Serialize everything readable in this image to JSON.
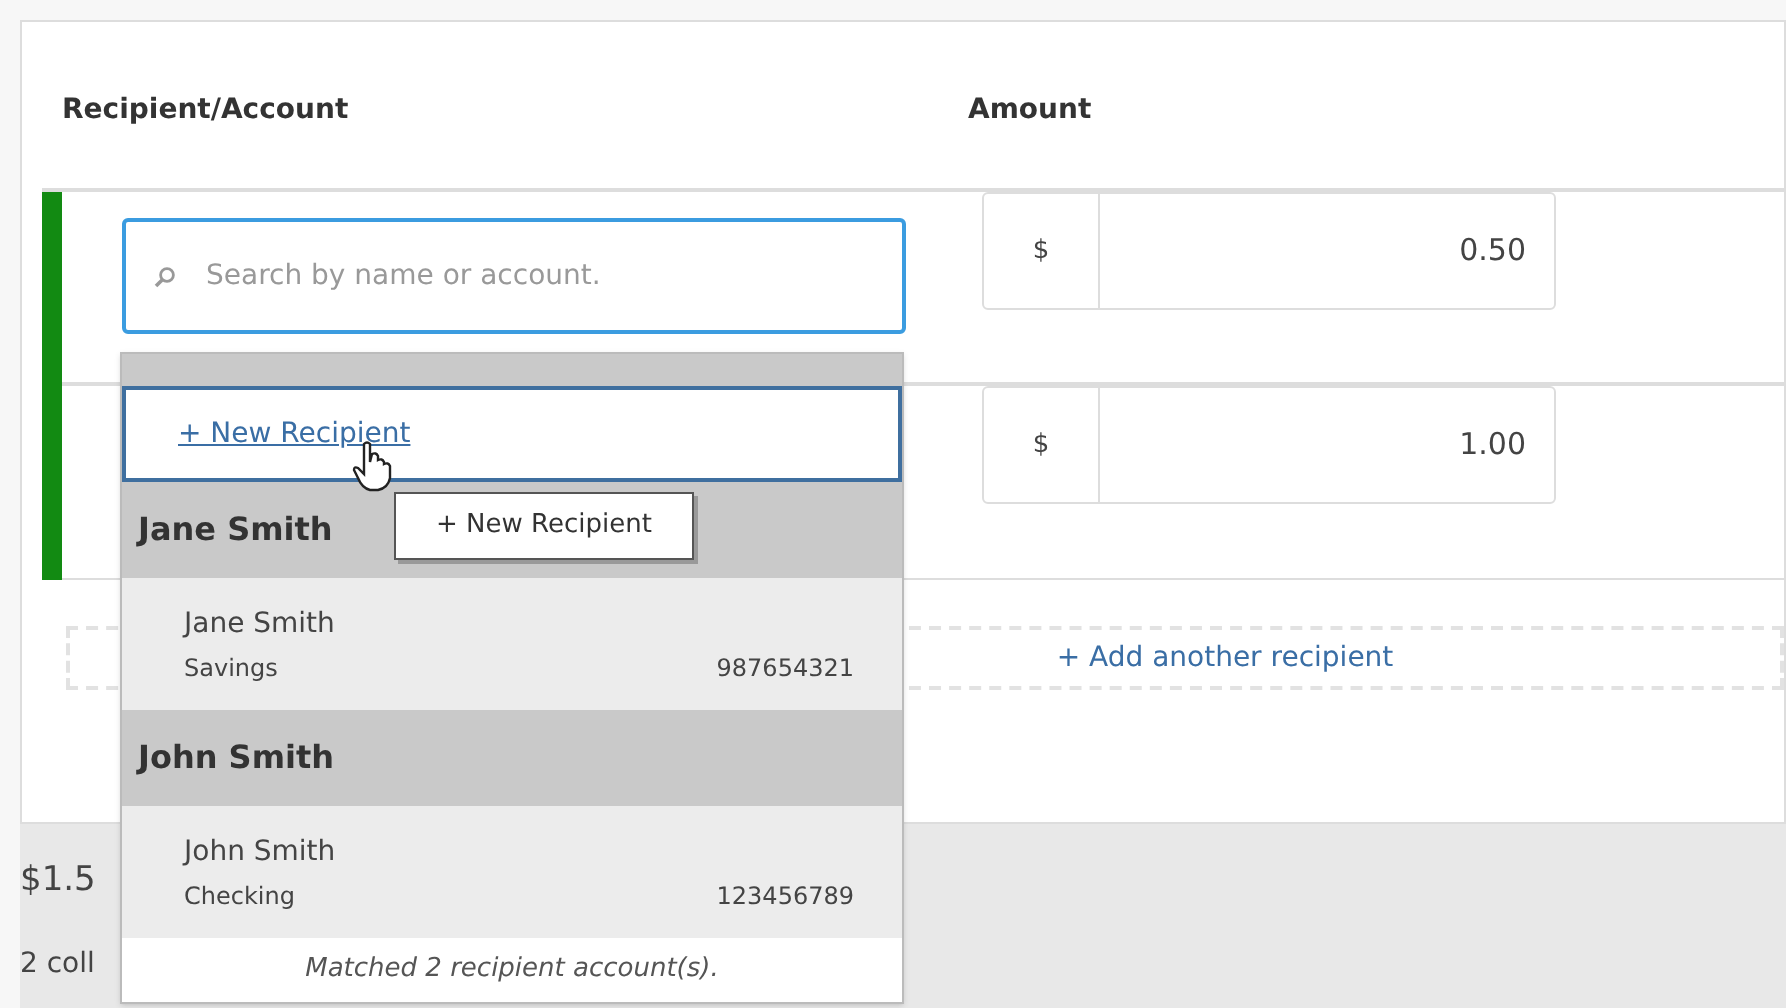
{
  "columns": [
    "Recipient/Account",
    "Amount"
  ],
  "search": {
    "placeholder": "Search by name or account."
  },
  "rows": [
    {
      "currency": "$",
      "amount": "0.50"
    },
    {
      "currency": "$",
      "amount": "1.00"
    }
  ],
  "add_link": "+ Add another recipient",
  "dropdown": {
    "new_item": {
      "label": "+ New Recipient",
      "selected": true
    },
    "groups": [
      {
        "name": "Jane Smith",
        "accounts": [
          {
            "name": "Jane Smith",
            "type": "Savings",
            "number": "987654321"
          }
        ]
      },
      {
        "name": "John Smith",
        "accounts": [
          {
            "name": "John Smith",
            "type": "Checking",
            "number": "123456789"
          }
        ]
      }
    ],
    "footer": "Matched 2 recipient account(s)."
  },
  "tooltip": "+ New Recipient",
  "summary": {
    "total": "$1.5",
    "count": "2 coll"
  }
}
